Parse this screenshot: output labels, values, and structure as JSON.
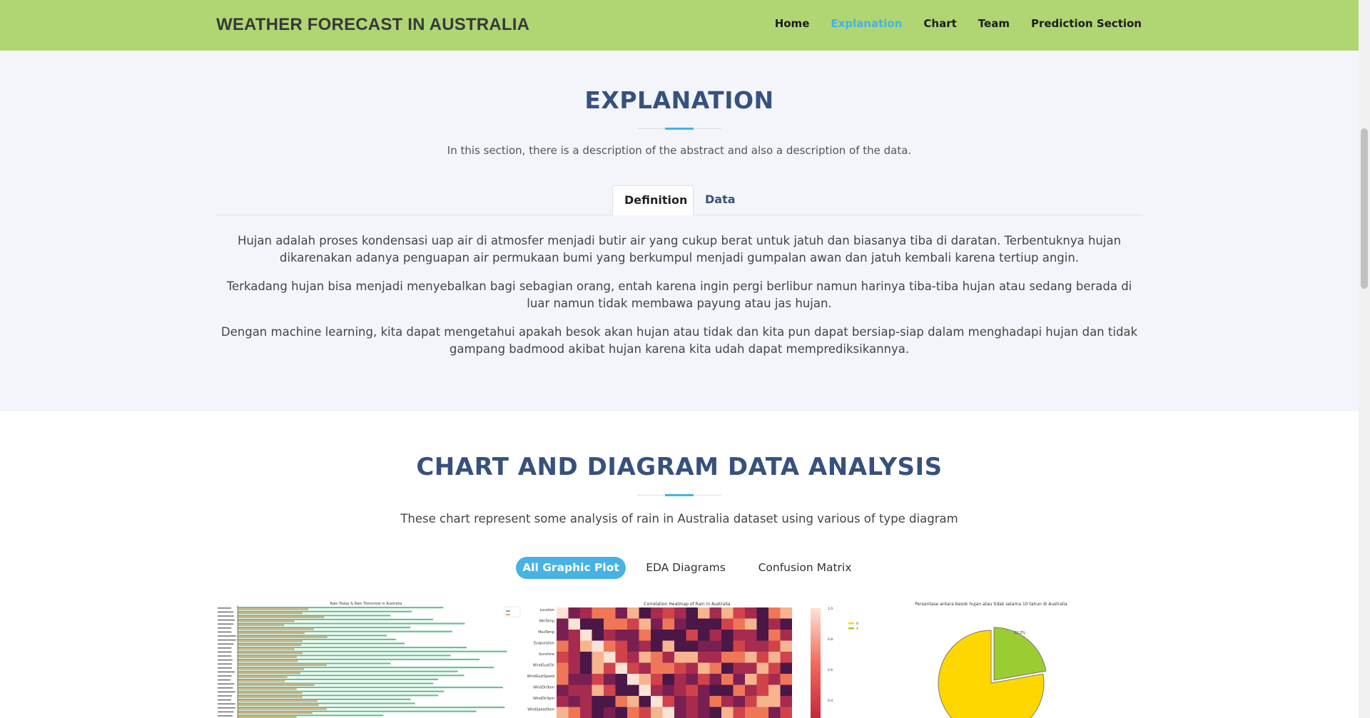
{
  "navbar": {
    "brand": "WEATHER FORECAST IN AUSTRALIA",
    "links": [
      "Home",
      "Explanation",
      "Chart",
      "Team",
      "Prediction Section"
    ],
    "active": "Explanation"
  },
  "explanation": {
    "title": "EXPLANATION",
    "subtitle": "In this section, there is a description of the abstract and also a description of the data.",
    "tabs": [
      "Definition",
      "Data"
    ],
    "active_tab": "Definition",
    "paragraphs": [
      "Hujan adalah proses kondensasi uap air di atmosfer menjadi butir air yang cukup berat untuk jatuh dan biasanya tiba di daratan. Terbentuknya hujan dikarenakan adanya penguapan air permukaan bumi yang berkumpul menjadi gumpalan awan dan jatuh kembali karena tertiup angin.",
      "Terkadang hujan bisa menjadi menyebalkan bagi sebagian orang, entah karena ingin pergi berlibur namun harinya tiba-tiba hujan atau sedang berada di luar namun tidak membawa payung atau jas hujan.",
      "Dengan machine learning, kita dapat mengetahui apakah besok akan hujan atau tidak dan kita pun dapat bersiap-siap dalam menghadapi hujan dan tidak gampang badmood akibat hujan karena kita udah dapat memprediksikannya."
    ]
  },
  "charts": {
    "title": "CHART AND DIAGRAM DATA ANALYSIS",
    "subtitle": "These chart represent some analysis of rain in Australia dataset using various of type diagram",
    "filters": [
      "All Graphic Plot",
      "EDA Diagrams",
      "Confusion Matrix"
    ],
    "active_filter": "All Graphic Plot",
    "thumbs": {
      "bar_title": "Rain Today & Rain Tomorrow in Australia",
      "heatmap_title": "Correlation Heatmap of Rain in Australia",
      "heatmap_rows": [
        "Location",
        "MinTemp",
        "MaxTemp",
        "Evaporation",
        "Sunshine",
        "WindGustDir",
        "WindGustSpeed",
        "WindDir9am",
        "WindDir3pm",
        "WindSpeed9am"
      ],
      "colorbar_ticks": [
        "1.0",
        "0.8",
        "0.6",
        "0.4"
      ],
      "pie_title": "Persentase antara besok hujan atau tidak selama 10 tahun di Australia",
      "pie_label": "22.2%",
      "pie_legend": [
        "0",
        "1"
      ],
      "pie_share_yes": 0.222
    }
  },
  "colors": {
    "navbar": "#b0d674",
    "accent": "#47b2e4",
    "title": "#37517e"
  }
}
